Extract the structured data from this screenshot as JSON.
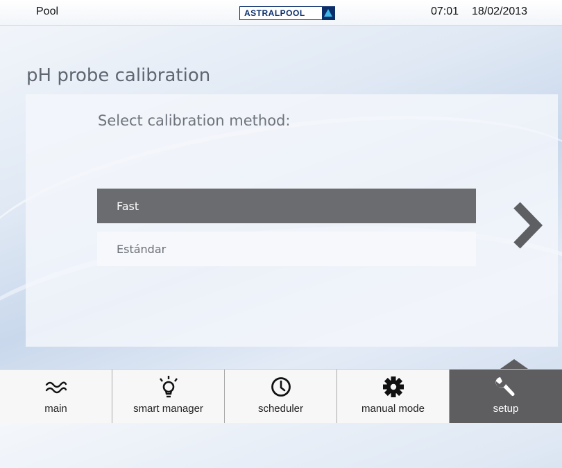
{
  "header": {
    "location": "Pool",
    "brand": "ASTRALPOOL",
    "time": "07:01",
    "date": "18/02/2013"
  },
  "page": {
    "title": "pH probe calibration",
    "prompt": "Select calibration method:"
  },
  "options": [
    {
      "label": "Fast",
      "selected": true
    },
    {
      "label": "Estándar",
      "selected": false
    }
  ],
  "next_icon": "chevron-right-icon",
  "nav": [
    {
      "label": "main",
      "icon": "approx-wave-icon",
      "active": false
    },
    {
      "label": "smart manager",
      "icon": "lightbulb-icon",
      "active": false
    },
    {
      "label": "scheduler",
      "icon": "clock-icon",
      "active": false
    },
    {
      "label": "manual mode",
      "icon": "gear-icon",
      "active": false
    },
    {
      "label": "setup",
      "icon": "wrench-icon",
      "active": true
    }
  ],
  "colors": {
    "selected_option": "#6b6c6f",
    "active_tab": "#5e5e60",
    "brand_blue": "#0b2e6b"
  }
}
